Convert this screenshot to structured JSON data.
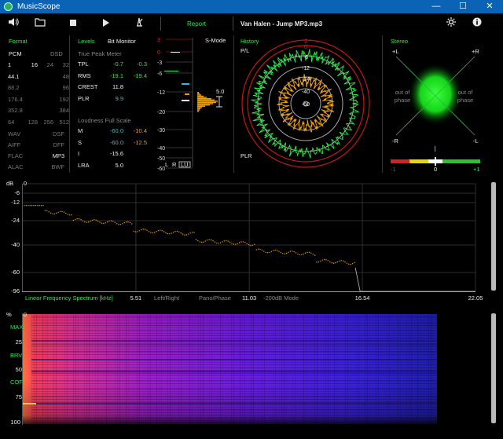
{
  "window": {
    "title": "MusicScope",
    "min": "—",
    "max": "☐",
    "close": "✕"
  },
  "toolbar": {
    "speaker_glyph": "🔊",
    "folder_glyph": "📁",
    "stop_glyph": "■",
    "play_glyph": "▶",
    "metronome_glyph": "♁",
    "report_label": "Report",
    "file_name": "Van Halen - Jump MP3.mp3",
    "settings_glyph": "✹",
    "info_glyph": "i"
  },
  "format": {
    "title": "Format",
    "pcm_label": "PCM",
    "dsd_label": "DSD",
    "rows": [
      [
        "1",
        "16",
        "24",
        "32"
      ],
      [
        "44.1",
        "",
        "",
        "48"
      ],
      [
        "88.2",
        "",
        "",
        "96"
      ],
      [
        "176.4",
        "",
        "",
        "192"
      ],
      [
        "352.8",
        "",
        "",
        "384"
      ],
      [
        "64",
        "128",
        "256",
        "512"
      ]
    ],
    "codecs": [
      [
        "WAV",
        "DSF"
      ],
      [
        "AIFF",
        "DFF"
      ],
      [
        "FLAC",
        "MP3"
      ],
      [
        "ALAC",
        "BWF"
      ]
    ]
  },
  "levels": {
    "title": "Levels",
    "mode": "Bit Monitor",
    "tp_title": "True Peak Meter",
    "tp_rows": [
      [
        "TPL",
        "-0.7",
        "-0.3"
      ],
      [
        "RMS",
        "-19.1",
        "-19.4"
      ],
      [
        "CREST",
        "11.8",
        ""
      ],
      [
        "PLR",
        "9.9",
        ""
      ]
    ],
    "lfs_title": "Loudness Full Scale",
    "lfs_rows": [
      [
        "M",
        "-60.0",
        "-10.4"
      ],
      [
        "S",
        "-60.0",
        "-12.5"
      ],
      [
        "I",
        "-15.6",
        ""
      ],
      [
        "LRA",
        "5.0",
        ""
      ]
    ]
  },
  "meter": {
    "mode": "S-Mode",
    "scale": [
      "3",
      "0",
      "-3",
      "-6",
      "-12",
      "-20",
      "-30",
      "-40",
      "-50",
      "-60"
    ],
    "plr_value": "5.0",
    "bottom_labels": [
      "L",
      "R",
      "LU"
    ]
  },
  "history": {
    "title": "History",
    "pl_label": "P/L",
    "plr_label": "PLR",
    "rings": [
      "3",
      "0",
      "-6",
      "-12",
      "-24",
      "-40",
      "-60"
    ]
  },
  "stereo": {
    "title": "Stereo",
    "corners": [
      "+L",
      "+R",
      "-R",
      "-L"
    ],
    "out_of_phase": "out of phase",
    "corr_scale": [
      "-1",
      "0",
      "+1"
    ],
    "correlation": 0.0
  },
  "spectrum": {
    "db_unit": "dB",
    "y_ticks": [
      "0",
      "-6",
      "-12",
      "-24",
      "-40",
      "-60",
      "-96"
    ],
    "title": "Linear Frequency Spectrum [kHz]",
    "x_ticks": [
      "5.51",
      "11.03",
      "16.54",
      "22.05"
    ],
    "buttons": [
      "Left/Right",
      "Pano/Phase",
      "-200dB Mode"
    ],
    "cutoff_khz": 16.2
  },
  "spectrogram": {
    "percent_unit": "%",
    "y_ticks": [
      "0",
      "25",
      "50",
      "75",
      "100"
    ],
    "markers": [
      "MAX",
      "BRV",
      "COF"
    ]
  },
  "colors": {
    "accent": "#2ee84a",
    "cyan": "#23c3d8",
    "orange": "#f0a000",
    "red": "#e02020"
  }
}
